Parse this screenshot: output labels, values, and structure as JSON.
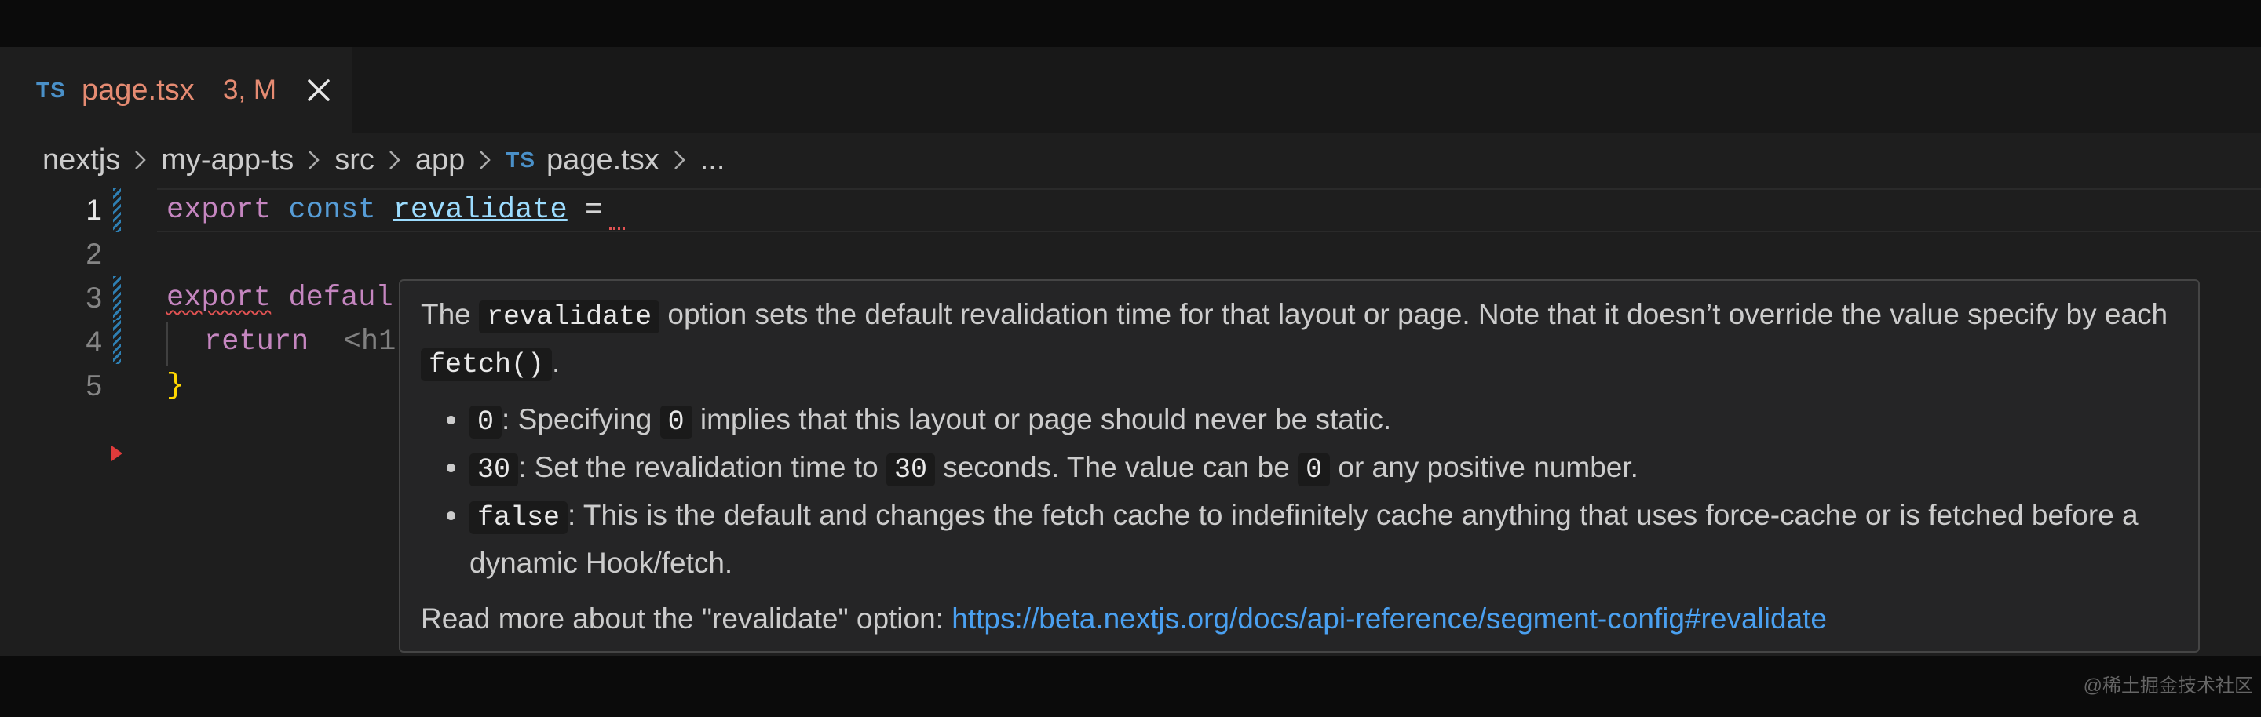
{
  "tab": {
    "badge": "TS",
    "filename": "page.tsx",
    "status": "3, M"
  },
  "breadcrumb": {
    "items": [
      "nextjs",
      "my-app-ts",
      "src",
      "app"
    ],
    "file_badge": "TS",
    "file": "page.tsx",
    "tail": "..."
  },
  "code": {
    "lines": [
      {
        "num": "1",
        "parts": [
          "export",
          "const",
          "revalidate",
          "="
        ]
      },
      {
        "num": "2",
        "parts": []
      },
      {
        "num": "3",
        "parts": [
          "export",
          "defaul"
        ]
      },
      {
        "num": "4",
        "parts": [
          "return",
          "<h1"
        ]
      },
      {
        "num": "5",
        "parts": [
          "}"
        ]
      }
    ]
  },
  "hover": {
    "intro": {
      "the": "The",
      "code": "revalidate",
      "text1": "option sets the default revalidation time for that layout or page. Note that it doesn’t override the value specify by each",
      "code2": "fetch()",
      "end": "."
    },
    "bullets": [
      {
        "code": "0",
        "text1": ": Specifying",
        "code2": "0",
        "text2": "implies that this layout or page should never be static."
      },
      {
        "code": "30",
        "text1": ": Set the revalidation time to",
        "code2": "30",
        "text2": "seconds. The value can be",
        "code3": "0",
        "text3": "or any positive number."
      },
      {
        "code": "false",
        "text1": ": This is the default and changes the fetch cache to indefinitely cache anything that uses force-cache or is fetched before a dynamic Hook/fetch."
      }
    ],
    "read_more": "Read more about the \"revalidate\" option:",
    "link": "https://beta.nextjs.org/docs/api-reference/segment-config#revalidate"
  },
  "watermark": "@稀土掘金技术社区",
  "colors": {
    "accent_link": "#4aa0f0",
    "tab_modified": "#e58b72",
    "ts_badge": "#4a90c8"
  }
}
